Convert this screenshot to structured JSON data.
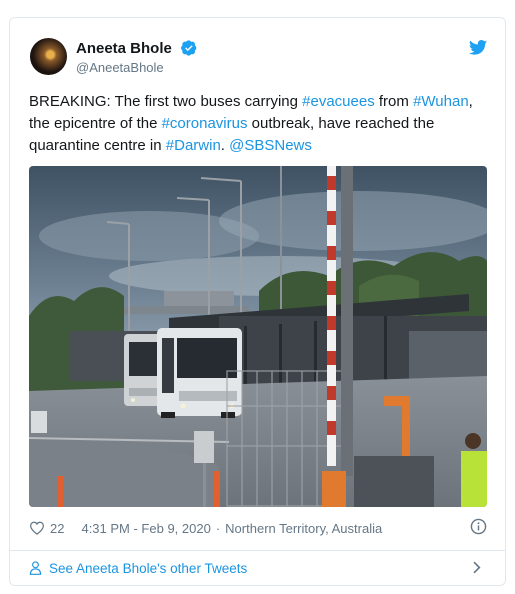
{
  "author": {
    "name": "Aneeta Bhole",
    "handle": "@AneetaBhole"
  },
  "tweet": {
    "parts": [
      {
        "text": "BREAKING: The first two buses carrying "
      },
      {
        "text": "#evacuees",
        "link": true
      },
      {
        "text": " from "
      },
      {
        "text": "#Wuhan",
        "link": true
      },
      {
        "text": ", the epicentre of the "
      },
      {
        "text": "#coronavirus",
        "link": true
      },
      {
        "text": " outbreak, have reached the quarantine centre in "
      },
      {
        "text": "#Darwin",
        "link": true
      },
      {
        "text": ". "
      },
      {
        "text": "@SBSNews",
        "link": true
      }
    ]
  },
  "meta": {
    "likes": "22",
    "time": "4:31 PM - Feb 9, 2020",
    "separator": "·",
    "location": "Northern Territory, Australia"
  },
  "footer": {
    "label": "See Aneeta Bhole's other Tweets"
  },
  "icons": {
    "verified": "verified-badge-icon",
    "bird": "twitter-bird-icon",
    "like": "heart-icon",
    "info": "info-icon",
    "profile": "person-icon",
    "chevron": "chevron-right-icon"
  },
  "colors": {
    "link": "#1b95e0",
    "muted": "#657786",
    "border": "#e1e8ed"
  }
}
